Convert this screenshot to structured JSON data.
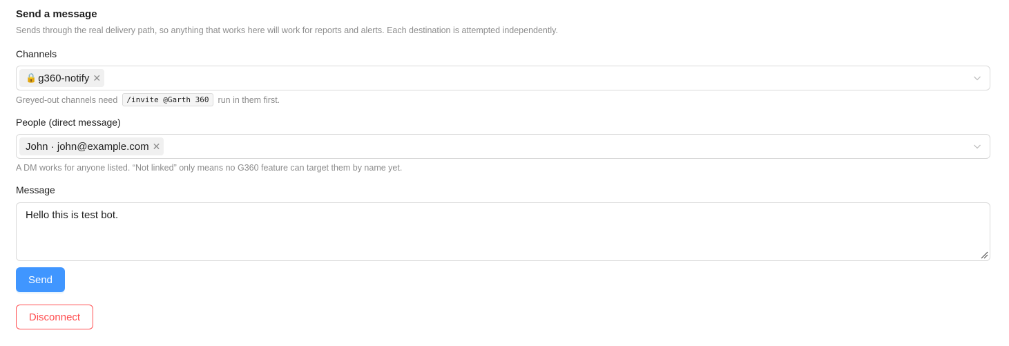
{
  "section": {
    "title": "Send a message",
    "subtitle": "Sends through the real delivery path, so anything that works here will work for reports and alerts. Each destination is attempted independently."
  },
  "channels": {
    "label": "Channels",
    "selected": [
      {
        "icon": "lock-icon",
        "name": "g360-notify"
      }
    ],
    "help_before": "Greyed-out channels need",
    "help_code": "/invite @Garth 360",
    "help_after": "run in them first."
  },
  "people": {
    "label": "People (direct message)",
    "selected": [
      {
        "name": "John · john@example.com"
      }
    ],
    "help": "A DM works for anyone listed. “Not linked” only means no G360 feature can target them by name yet."
  },
  "message": {
    "label": "Message",
    "value": "Hello this is test bot."
  },
  "buttons": {
    "send": "Send",
    "disconnect": "Disconnect"
  },
  "colors": {
    "primary": "#4096ff",
    "danger": "#ff4d4f",
    "border": "#d9d9d9",
    "muted": "#8c8c8c"
  }
}
